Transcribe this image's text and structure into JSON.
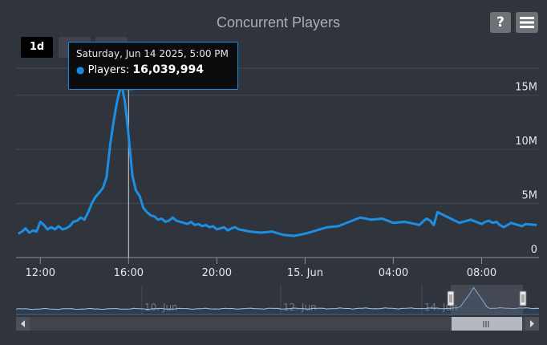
{
  "chart_data": {
    "type": "line",
    "title": "Concurrent Players",
    "series": [
      {
        "name": "Players",
        "color": "#1c8fe4",
        "x": [
          11.0,
          11.17,
          11.33,
          11.5,
          11.67,
          11.83,
          12.0,
          12.17,
          12.33,
          12.5,
          12.67,
          12.83,
          13.0,
          13.17,
          13.33,
          13.5,
          13.67,
          13.83,
          14.0,
          14.17,
          14.33,
          14.5,
          14.67,
          14.83,
          15.0,
          15.17,
          15.33,
          15.5,
          15.67,
          15.83,
          16.0,
          16.17,
          16.33,
          16.5,
          16.67,
          16.83,
          17.0,
          17.17,
          17.33,
          17.5,
          17.67,
          17.83,
          18.0,
          18.17,
          18.33,
          18.5,
          18.67,
          18.83,
          19.0,
          19.17,
          19.33,
          19.5,
          19.67,
          19.83,
          20.0,
          20.17,
          20.33,
          20.5,
          20.67,
          20.83,
          21.0,
          21.5,
          22.0,
          22.5,
          23.0,
          23.5,
          24.0,
          24.5,
          25.0,
          25.5,
          26.0,
          26.5,
          27.0,
          27.5,
          28.0,
          28.5,
          29.0,
          29.17,
          29.33,
          29.5,
          29.67,
          29.83,
          30.0,
          30.5,
          31.0,
          31.5,
          32.0,
          32.17,
          32.33,
          32.5,
          32.67,
          32.83,
          33.0,
          33.17,
          33.33,
          33.5,
          33.67,
          33.83,
          34.0,
          34.5
        ],
        "y": [
          2.2,
          2.4,
          2.7,
          2.3,
          2.5,
          2.4,
          3.3,
          3.0,
          2.6,
          2.8,
          2.6,
          2.9,
          2.6,
          2.7,
          2.9,
          3.3,
          3.4,
          3.7,
          3.5,
          4.2,
          5.0,
          5.6,
          6.0,
          6.4,
          7.4,
          10.5,
          12.7,
          14.6,
          16.04,
          14.5,
          11.3,
          7.6,
          6.2,
          5.7,
          4.6,
          4.2,
          3.9,
          3.8,
          3.5,
          3.6,
          3.3,
          3.4,
          3.7,
          3.4,
          3.3,
          3.2,
          3.1,
          3.3,
          3.0,
          3.1,
          2.9,
          3.0,
          2.8,
          2.9,
          2.6,
          2.7,
          2.8,
          2.5,
          2.7,
          2.8,
          2.6,
          2.4,
          2.3,
          2.4,
          2.1,
          2.0,
          2.2,
          2.5,
          2.8,
          2.9,
          3.3,
          3.7,
          3.5,
          3.6,
          3.2,
          3.3,
          3.1,
          3.0,
          3.3,
          3.6,
          3.4,
          3.0,
          4.2,
          3.7,
          3.2,
          3.5,
          3.1,
          3.3,
          3.4,
          3.2,
          3.3,
          3.0,
          2.8,
          3.0,
          3.2,
          3.1,
          3.0,
          2.9,
          3.1,
          3.0
        ],
        "unit": "M"
      }
    ],
    "x_range_hours": [
      10.9,
      34.6
    ],
    "ylim": [
      0,
      17.5
    ],
    "y_ticks": [
      {
        "value": 0,
        "label": "0"
      },
      {
        "value": 5,
        "label": "5M"
      },
      {
        "value": 10,
        "label": "10M"
      },
      {
        "value": 15,
        "label": "15M"
      }
    ],
    "x_ticks": [
      {
        "value": 12,
        "label": "12:00"
      },
      {
        "value": 16,
        "label": "16:00"
      },
      {
        "value": 20,
        "label": "20:00"
      },
      {
        "value": 24,
        "label": "15. Jun"
      },
      {
        "value": 28,
        "label": "04:00"
      },
      {
        "value": 32,
        "label": "08:00"
      }
    ],
    "grid": true,
    "legend": "none",
    "highlight": {
      "x": 16.0,
      "y": 16.04
    }
  },
  "range_buttons": [
    {
      "label": "1d",
      "active": true
    },
    {
      "label": "",
      "active": false
    },
    {
      "label": "",
      "active": false
    }
  ],
  "tooltip": {
    "date": "Saturday, Jun 14 2025, 5:00 PM",
    "series_label": "Players:",
    "value": "16,039,994"
  },
  "buttons": {
    "help": "?",
    "menu_icon": "hamburger-menu-icon"
  },
  "navigator": {
    "labels": [
      "10. Jun",
      "12. Jun",
      "14. Jun"
    ],
    "selection_handle_icon": "grip-icon",
    "scroll_left_icon": "left-arrow-icon",
    "scroll_right_icon": "right-arrow-icon"
  },
  "colors": {
    "background": "#2f343d",
    "grid": "#454b55",
    "line": "#1c8fe4",
    "tooltip_border": "#1a8ae0"
  }
}
